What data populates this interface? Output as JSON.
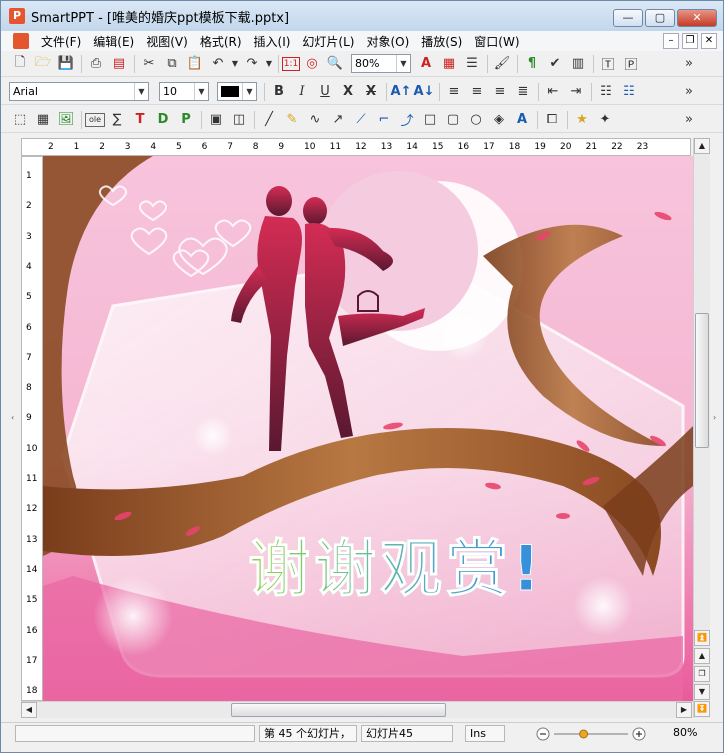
{
  "window": {
    "app_name": "SmartPPT",
    "title": "SmartPPT - [唯美的婚庆ppt模板下载.pptx]",
    "btn_minimize": "—",
    "btn_maximize": "▢",
    "btn_close": "✕"
  },
  "menu": {
    "items": [
      "文件(F)",
      "编辑(E)",
      "视图(V)",
      "格式(R)",
      "插入(I)",
      "幻灯片(L)",
      "对象(O)",
      "播放(S)",
      "窗口(W)"
    ]
  },
  "toolbar1": {
    "zoom_value": "80%",
    "zoom_badge": "1:1",
    "more": "»"
  },
  "toolbar2": {
    "font_name": "Arial",
    "font_size": "10",
    "bold": "B",
    "italic": "I",
    "underline": "U",
    "shadow": "X",
    "strike": "X",
    "more": "»"
  },
  "toolbar3": {
    "more": "»"
  },
  "ruler": {
    "h_labels": [
      "2",
      "1",
      "2",
      "3",
      "4",
      "5",
      "6",
      "7",
      "8",
      "9",
      "10",
      "11",
      "12",
      "13",
      "14",
      "15",
      "16",
      "17",
      "18",
      "19",
      "20",
      "21",
      "22",
      "23"
    ],
    "v_labels": [
      "1",
      "2",
      "3",
      "4",
      "5",
      "6",
      "7",
      "8",
      "9",
      "10",
      "11",
      "12",
      "13",
      "14",
      "15",
      "16",
      "17",
      "18"
    ],
    "corner": "+"
  },
  "slide": {
    "thank_you_text": "谢谢观赏!"
  },
  "status": {
    "slide_count": "第 45 个幻灯片，",
    "slide_name": "幻灯片45",
    "insert_mode": "Ins",
    "zoom_percent": "80%",
    "zoom_level": 0.4
  },
  "colors": {
    "title_gradient": "#c2d6ec",
    "close_red": "#c53b26",
    "slide_pink": "#f48bb8",
    "ribbon_brown": "#9b5a2a",
    "text_green": "#8dcc45",
    "text_blue": "#3a8ee0"
  }
}
